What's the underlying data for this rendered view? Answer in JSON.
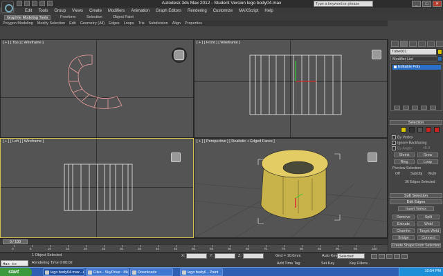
{
  "window": {
    "title": "Autodesk 3ds Max  2012  - Student Version   lego body04.max",
    "search_placeholder": "Type a keyword or phrase",
    "controls": [
      "_",
      "□",
      "✕"
    ]
  },
  "menubar": [
    "Edit",
    "Tools",
    "Group",
    "Views",
    "Create",
    "Modifiers",
    "Animation",
    "Graph Editors",
    "Rendering",
    "Customize",
    "MAXScript",
    "Help"
  ],
  "ribbon": {
    "tabs": [
      "Graphite Modeling Tools",
      "Freeform",
      "Selection",
      "Object Paint"
    ],
    "active_tab": 0,
    "sub_items": [
      "Polygon Modeling",
      "Modify Selection",
      "Edit",
      "Geometry (All)",
      "Edges",
      "Loops",
      "Tris",
      "Subdivision",
      "Align",
      "Properties"
    ]
  },
  "viewports": {
    "top": {
      "label": "[ + ] [ Top ] [ Wireframe ]"
    },
    "front": {
      "label": "[ + ] [ Front ] [ Wireframe ]"
    },
    "left": {
      "label": "[ + ] [ Left ] [ Wireframe ]"
    },
    "perspective": {
      "label": "[ + ] [ Perspective ] [ Realistic + Edged Faces ]"
    }
  },
  "command_panel": {
    "object_name": "Tube001",
    "object_color": "#d9c600",
    "modifier_list_label": "Modifier List",
    "stack_items": [
      "Editable Poly"
    ],
    "selection": {
      "header": "Selection",
      "by_vertex": "By Vertex",
      "ignore_backfacing": "Ignore Backfacing",
      "by_angle": "By Angle:",
      "by_angle_value": "45.0",
      "shrink": "Shrink",
      "grow": "Grow",
      "ring": "Ring",
      "loop": "Loop",
      "preview_header": "Preview Selection",
      "preview_off": "Off",
      "preview_subobj": "SubObj",
      "preview_multi": "Multi",
      "status": "36 Edges Selected"
    },
    "soft_selection": "Soft Selection",
    "edit_edges": {
      "header": "Edit Edges",
      "insert_vertex": "Insert Vertex",
      "remove": "Remove",
      "split": "Split",
      "extrude": "Extrude",
      "weld": "Weld",
      "chamfer": "Chamfer",
      "target_weld": "Target Weld",
      "bridge": "Bridge",
      "connect": "Connect",
      "create_shape": "Create Shape From Selection"
    }
  },
  "timeline": {
    "slider_label": "0 / 100",
    "ticks": [
      "0",
      "5",
      "10",
      "15",
      "20",
      "25",
      "30",
      "35",
      "40",
      "45",
      "50",
      "55",
      "60",
      "65",
      "70",
      "75",
      "80",
      "85",
      "90",
      "95",
      "100"
    ]
  },
  "status": {
    "maxscript_text": "Max to Physc",
    "selected": "1 Object Selected",
    "render_time": "Rendering Time  0:00:02",
    "x_label": "X:",
    "y_label": "Y:",
    "z_label": "Z:",
    "grid": "Grid = 10.0mm",
    "add_time_tag": "Add Time Tag",
    "auto_key": "Auto Key",
    "set_key": "Set Key",
    "key_mode": "Selected",
    "key_filters": "Key Filters..."
  },
  "taskbar": {
    "start": "start",
    "items": [
      "lego body04.max - A...",
      "Files - SkyDrive - Micr...",
      "Downloads",
      "lego body6 - Paint"
    ],
    "active_index": 0,
    "clock": "10:54 PM"
  }
}
